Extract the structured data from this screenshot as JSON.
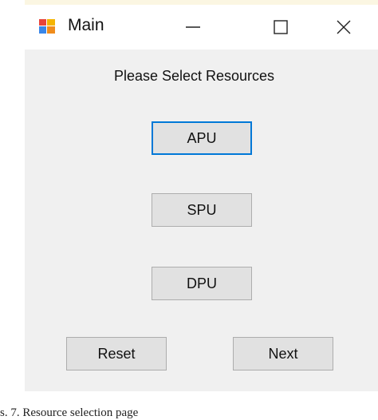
{
  "window": {
    "title": "Main",
    "controls": {
      "minimize": "minimize-icon",
      "maximize": "maximize-icon",
      "close": "close-icon"
    }
  },
  "form": {
    "heading": "Please Select Resources",
    "resource_buttons": [
      "APU",
      "SPU",
      "DPU"
    ],
    "focused_button": "APU",
    "reset_label": "Reset",
    "next_label": "Next"
  },
  "caption": "s. 7. Resource selection page",
  "colors": {
    "window_bg": "#f0f0f0",
    "button_bg": "#e1e1e1",
    "focus_border": "#0078d7"
  }
}
